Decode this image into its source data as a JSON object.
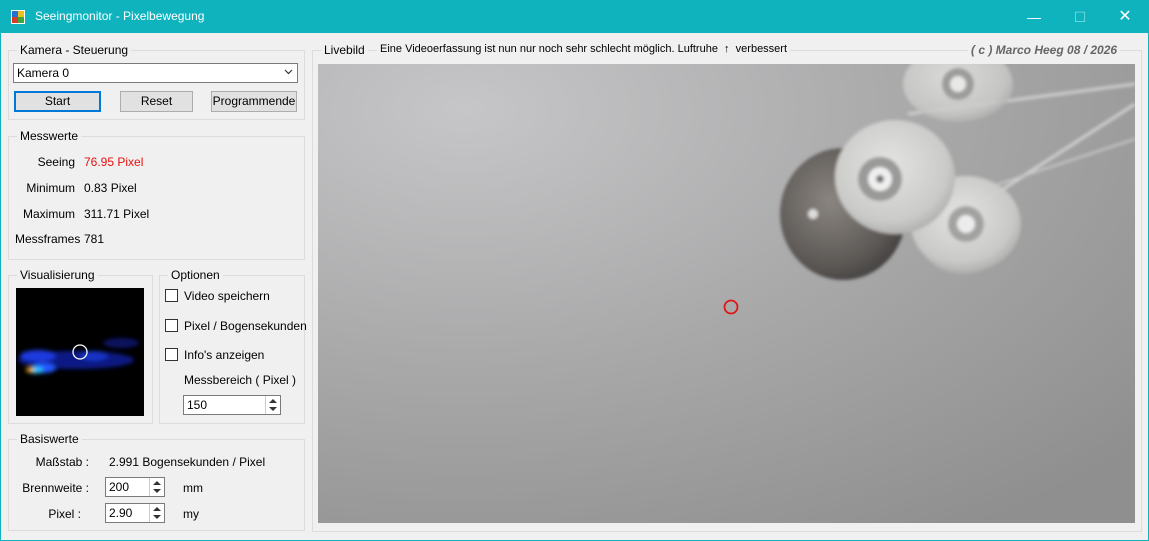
{
  "window": {
    "title": "Seeingmonitor - Pixelbewegung",
    "controls": {
      "minimize": "—",
      "maximize": "☐",
      "close": "✕"
    }
  },
  "camera_group": {
    "legend": "Kamera - Steuerung",
    "select_value": "Kamera 0",
    "start_label": "Start",
    "reset_label": "Reset",
    "end_label": "Programmende"
  },
  "measurements": {
    "legend": "Messwerte",
    "seeing_label": "Seeing",
    "seeing_value": "76.95 Pixel",
    "minimum_label": "Minimum",
    "minimum_value": "0.83 Pixel",
    "maximum_label": "Maximum",
    "maximum_value": "311.71 Pixel",
    "frames_label": "Messframes",
    "frames_value": "781",
    "seeing_color": "#e81010"
  },
  "visualization": {
    "legend": "Visualisierung"
  },
  "options": {
    "legend": "Optionen",
    "video_label": "Video speichern",
    "video_checked": false,
    "arcsec_label": "Pixel / Bogensekunden",
    "arcsec_checked": false,
    "info_label": "Info's anzeigen",
    "info_checked": false,
    "range_label": "Messbereich ( Pixel )",
    "range_value": "150"
  },
  "base": {
    "legend": "Basiswerte",
    "scale_label": "Maßstab :",
    "scale_value": "2.991 Bogensekunden / Pixel",
    "focal_label": "Brennweite :",
    "focal_value": "200",
    "focal_unit": "mm",
    "pixel_label": "Pixel :",
    "pixel_value": "2.90",
    "pixel_unit": "my"
  },
  "live": {
    "legend": "Livebild",
    "status_text": "Eine Videoerfassung ist nun nur noch sehr schlecht möglich. Luftruhe  ↑  verbessert",
    "copyright": "( c ) Marco Heeg 08 / 2026",
    "target_color": "#e01515"
  },
  "accent_color": "#0fb3be"
}
